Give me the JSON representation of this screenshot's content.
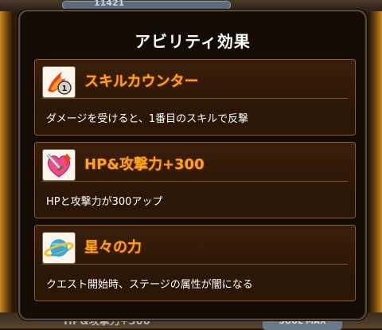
{
  "background": {
    "top_hp_text": "11421",
    "bottom_peek_text": "HP&攻撃力+300",
    "bottom_button": "SOUL MAX"
  },
  "modal": {
    "title": "アビリティ効果",
    "abilities": [
      {
        "name": "スキルカウンター",
        "description": "ダメージを受けると、1番目のスキルで反撃",
        "icon": "flame-counter-icon"
      },
      {
        "name": "HP&攻撃力+300",
        "description": "HPと攻撃力が300アップ",
        "icon": "heart-sword-icon"
      },
      {
        "name": "星々の力",
        "description": "クエスト開始時、ステージの属性が闇になる",
        "icon": "planet-icon"
      }
    ]
  },
  "colors": {
    "ability_name": "#f5a623",
    "card_border": "#8a5d2c",
    "modal_bg": "#150c05"
  }
}
